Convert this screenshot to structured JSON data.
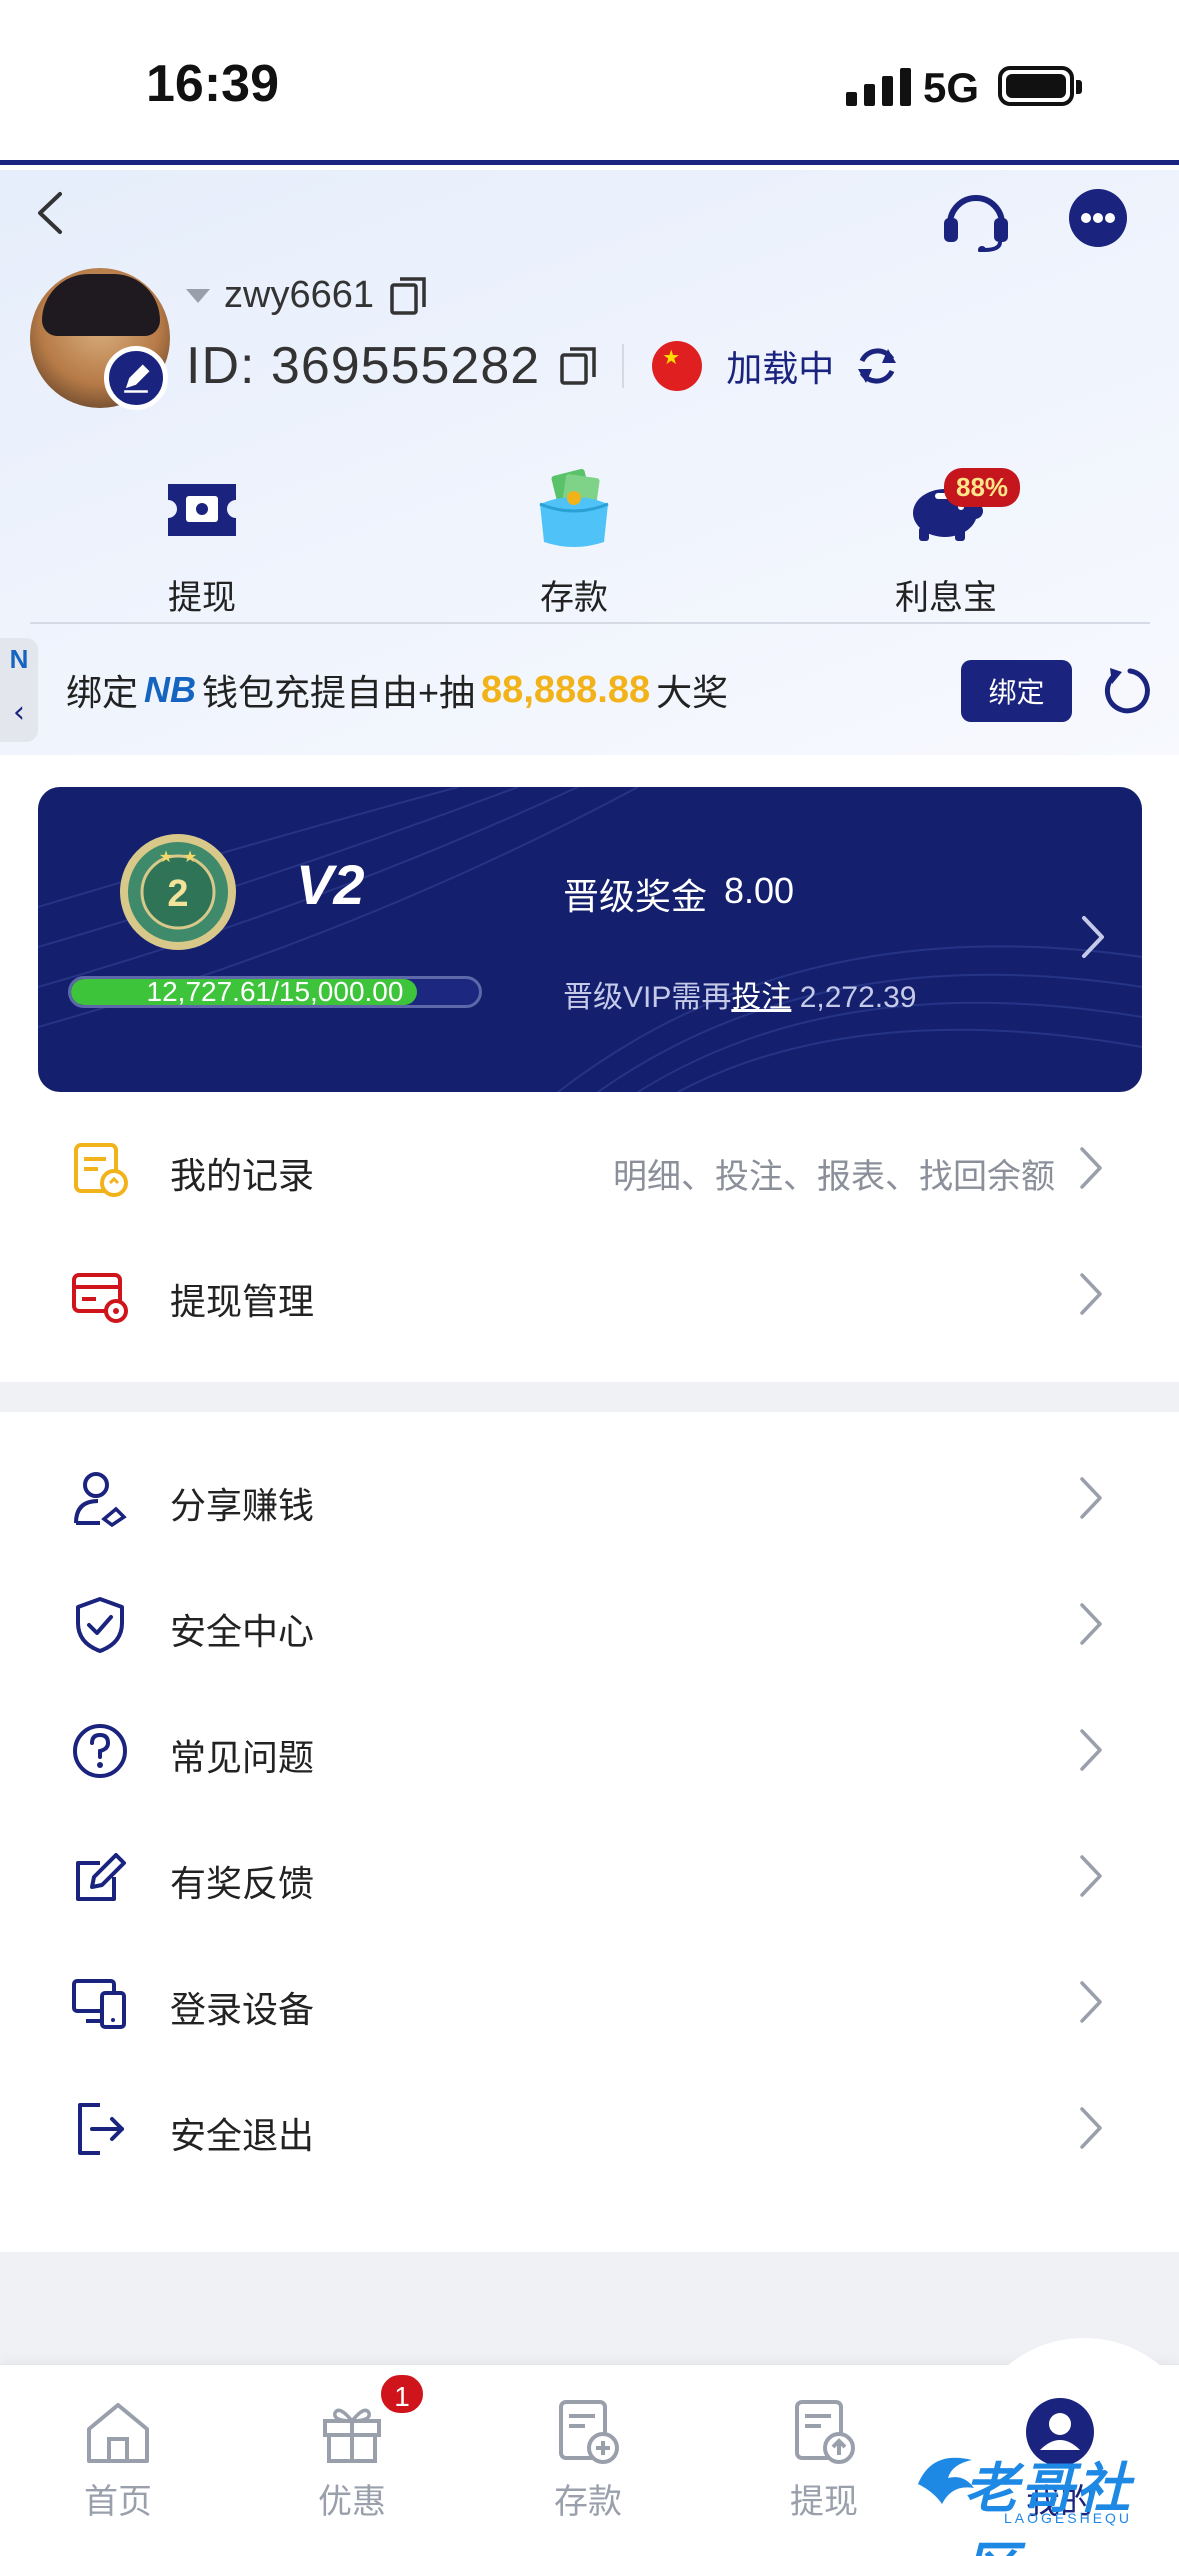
{
  "status_bar": {
    "time": "16:39",
    "network": "5G"
  },
  "profile": {
    "username": "zwy6661",
    "id_label": "ID: 369555282",
    "region_status": "加载中"
  },
  "quick_actions": [
    {
      "label": "提现",
      "icon": "withdraw-ticket-icon"
    },
    {
      "label": "存款",
      "icon": "wallet-money-icon"
    },
    {
      "label": "利息宝",
      "icon": "piggy-bank-icon",
      "badge": "88%"
    }
  ],
  "promo": {
    "prefix": "绑定",
    "brand": "NB",
    "middle": "钱包充提自由+抽",
    "amount": "88,888.88",
    "suffix": "大奖",
    "bind_label": "绑定",
    "tab_letter": "N"
  },
  "vip": {
    "level": "V2",
    "medal_number": "2",
    "progress_text": "12,727.61/15,000.00",
    "progress_fraction": 0.8485,
    "bonus_label": "晋级奖金",
    "bonus_value": "8.00",
    "requirement_prefix": "晋级VIP需再",
    "requirement_link": "投注",
    "requirement_value": "2,272.39"
  },
  "menu_group1": [
    {
      "label": "我的记录",
      "hint": "明细、投注、报表、找回余额",
      "icon": "records-icon"
    },
    {
      "label": "提现管理",
      "hint": "",
      "icon": "card-settings-icon"
    }
  ],
  "menu_group2": [
    {
      "label": "分享赚钱",
      "icon": "share-user-icon"
    },
    {
      "label": "安全中心",
      "icon": "shield-check-icon"
    },
    {
      "label": "常见问题",
      "icon": "question-circle-icon"
    },
    {
      "label": "有奖反馈",
      "icon": "edit-feedback-icon"
    },
    {
      "label": "登录设备",
      "icon": "devices-icon"
    },
    {
      "label": "安全退出",
      "icon": "logout-icon"
    }
  ],
  "tabbar": [
    {
      "label": "首页",
      "icon": "home-icon"
    },
    {
      "label": "优惠",
      "icon": "gift-icon",
      "badge": "1"
    },
    {
      "label": "存款",
      "icon": "deposit-doc-icon"
    },
    {
      "label": "提现",
      "icon": "withdraw-doc-icon"
    },
    {
      "label": "我的",
      "icon": "user-avatar-icon"
    }
  ],
  "watermark": {
    "text": "老哥社区",
    "sub": "LAOGESHEQU"
  },
  "colors": {
    "brand": "#1a237e",
    "accent_gold": "#f2b21a",
    "progress_green": "#3ec43a",
    "badge_red": "#c4161c"
  }
}
